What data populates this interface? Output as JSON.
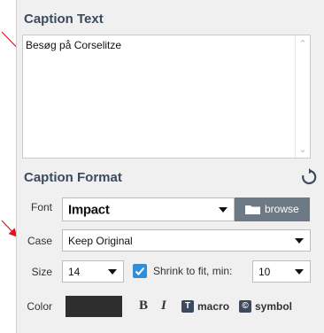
{
  "caption_section": {
    "title": "Caption Text",
    "text": "Besøg på Corselitze"
  },
  "format_section": {
    "title": "Caption Format",
    "font": {
      "label": "Font",
      "value": "Impact",
      "browse_label": "browse"
    },
    "case": {
      "label": "Case",
      "value": "Keep Original"
    },
    "size": {
      "label": "Size",
      "value": "14",
      "shrink_label": "Shrink to fit, min:",
      "shrink_checked": true,
      "min_value": "10"
    },
    "color": {
      "label": "Color",
      "swatch": "#2e2e2e"
    },
    "tools": {
      "bold": "B",
      "italic": "I",
      "macro": "macro",
      "symbol": "symbol"
    }
  },
  "colors": {
    "accent": "#2f8fdb",
    "title": "#3d4a5c",
    "annotation_arrow": "#e0141e"
  }
}
